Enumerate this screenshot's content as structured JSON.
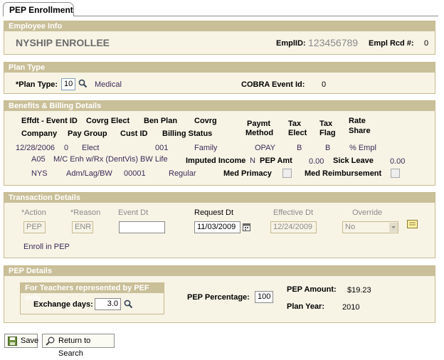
{
  "page_tab": "PEP Enrollment",
  "employee_info": {
    "title": "Employee Info",
    "name": "NYSHIP ENROLLEE",
    "emplid_label": "EmplID:",
    "emplid": "123456789",
    "rcd_label": "Empl Rcd #:",
    "rcd": "0"
  },
  "plan_type": {
    "title": "Plan Type",
    "label": "*Plan Type:",
    "value": "10",
    "desc": "Medical",
    "cobra_label": "COBRA Event Id:",
    "cobra_value": "0"
  },
  "benefits": {
    "title": "Benefits & Billing Details",
    "headers": {
      "effdt_event": "Effdt - Event ID",
      "covrg_elect": "Covrg Elect",
      "ben_plan": "Ben Plan",
      "covrg": "Covrg",
      "paymt_method": "Paymt Method",
      "paymt_1": "Paymt",
      "paymt_2": "Method",
      "tax_elect_1": "Tax",
      "tax_elect_2": "Elect",
      "tax_flag_1": "Tax",
      "tax_flag_2": "Flag",
      "rate_share_1": "Rate",
      "rate_share_2": "Share",
      "company": "Company",
      "pay_group": "Pay Group",
      "cust_id": "Cust ID",
      "billing_status": "Billing Status"
    },
    "row1": {
      "effdt": "12/28/2006",
      "event_id": "0",
      "covrg_elect": "Elect",
      "ben_plan": "001",
      "covrg": "Family",
      "paymt_method": "OPAY",
      "tax_elect": "B",
      "tax_flag": "B",
      "rate_share": "% Empl"
    },
    "row2": {
      "plan_code": "A05",
      "plan_desc": "M/C Enh w/Rx (DentVis) BW Life",
      "imputed_income_label": "Imputed Income",
      "imputed_income": "N",
      "pep_amt_label": "PEP Amt",
      "pep_amt": "0.00",
      "sick_leave_label": "Sick Leave",
      "sick_leave": "0.00"
    },
    "row3": {
      "company": "NYS",
      "pay_group": "Adm/Lag/BW",
      "cust_id": "00001",
      "billing_status": "Regular",
      "med_primacy_label": "Med Primacy",
      "med_reimb_label": "Med Reimbursement"
    }
  },
  "transaction": {
    "title": "Transaction Details",
    "action_label": "*Action",
    "reason_label": "*Reason",
    "event_dt_label": "Event Dt",
    "request_dt_label": "Request Dt",
    "effective_dt_label": "Effective Dt",
    "override_label": "Override",
    "action": "PEP",
    "reason": "ENR",
    "event_dt": "",
    "request_dt": "11/03/2009",
    "effective_dt": "12/24/2009",
    "override": "No",
    "reason_desc": "Enroll in PEP"
  },
  "pep_details": {
    "title": "PEP Details",
    "teachers_title": "For Teachers represented by PEF only",
    "exchange_days_label": "Exchange days:",
    "exchange_days": "3.0",
    "pep_percentage_label": "PEP Percentage:",
    "pep_percentage": "100",
    "pep_amount_label": "PEP Amount:",
    "pep_amount": "$19.23",
    "plan_year_label": "Plan Year:",
    "plan_year": "2010"
  },
  "buttons": {
    "save": "Save",
    "return": "Return to Search"
  }
}
